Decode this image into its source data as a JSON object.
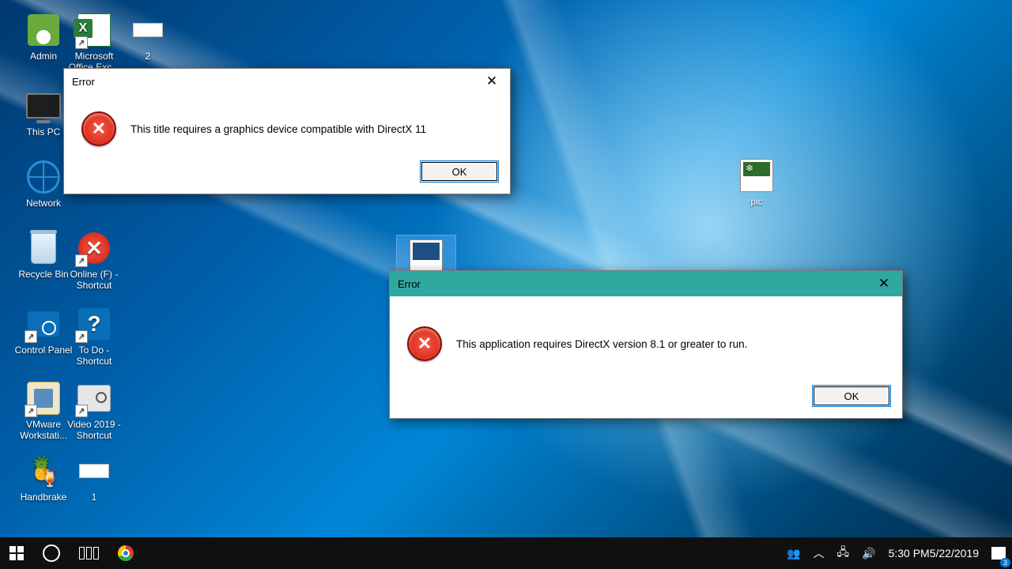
{
  "desktop_icons": {
    "admin": {
      "label": "Admin"
    },
    "excel": {
      "label": "Microsoft Office Exc..."
    },
    "file2": {
      "label": "2"
    },
    "this_pc": {
      "label": "This PC"
    },
    "network": {
      "label": "Network"
    },
    "recycle": {
      "label": "Recycle Bin"
    },
    "online": {
      "label": "Online (F) - Shortcut"
    },
    "control": {
      "label": "Control Panel"
    },
    "todo": {
      "label": "To Do - Shortcut"
    },
    "vmware": {
      "label": "VMware Workstati..."
    },
    "video": {
      "label": "Video 2019 - Shortcut"
    },
    "handbrake": {
      "label": "Handbrake"
    },
    "file1": {
      "label": "1"
    },
    "pic": {
      "label": "pic"
    },
    "selected_file": {
      "label": ""
    }
  },
  "dialog1": {
    "title": "Error",
    "message": "This title requires a graphics device compatible with DirectX 11",
    "ok": "OK"
  },
  "dialog2": {
    "title": "Error",
    "message": "This application requires DirectX version 8.1 or greater to run.",
    "ok": "OK"
  },
  "taskbar": {
    "time": "5:30 PM",
    "date": "5/22/2019",
    "notif_count": "3"
  }
}
